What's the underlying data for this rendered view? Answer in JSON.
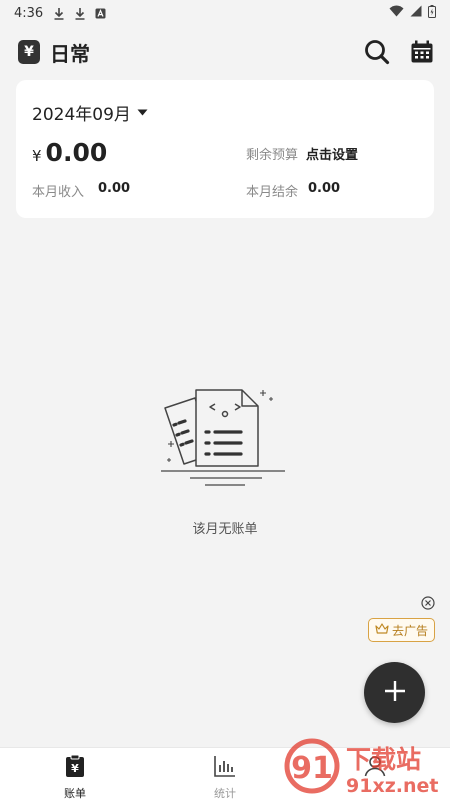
{
  "status_bar": {
    "time": "4:36",
    "icons": [
      "download-icon",
      "download-icon",
      "a-badge-icon",
      "wifi-icon",
      "signal-icon",
      "battery-icon"
    ]
  },
  "app_bar": {
    "logo_glyph": "¥",
    "title": "日常",
    "actions": [
      "search-icon",
      "calendar-icon"
    ]
  },
  "summary": {
    "month": "2024年09月",
    "currency": "¥",
    "expense_amount": "0.00",
    "budget_label": "剩余预算",
    "budget_action": "点击设置",
    "income_label": "本月收入",
    "income_value": "0.00",
    "balance_label": "本月结余",
    "balance_value": "0.00"
  },
  "empty_state": {
    "text": "该月无账单"
  },
  "ad": {
    "label": "去广告",
    "close": "close-icon",
    "crown": "crown-icon"
  },
  "fab": {
    "icon": "plus-icon"
  },
  "bottom_nav": {
    "items": [
      {
        "label": "账单",
        "icon": "bill-icon",
        "active": true
      },
      {
        "label": "统计",
        "icon": "chart-icon",
        "active": false
      },
      {
        "label": "",
        "icon": "user-icon",
        "active": false
      }
    ]
  },
  "watermark": {
    "brand": "下载站",
    "site": "91xz.net",
    "logo": "91"
  },
  "colors": {
    "background": "#f3f3f3",
    "card": "#ffffff",
    "primary": "#2f2f2f",
    "muted": "#8a8a8a",
    "ad_accent": "#d8a244",
    "watermark": "#e23b2e"
  }
}
